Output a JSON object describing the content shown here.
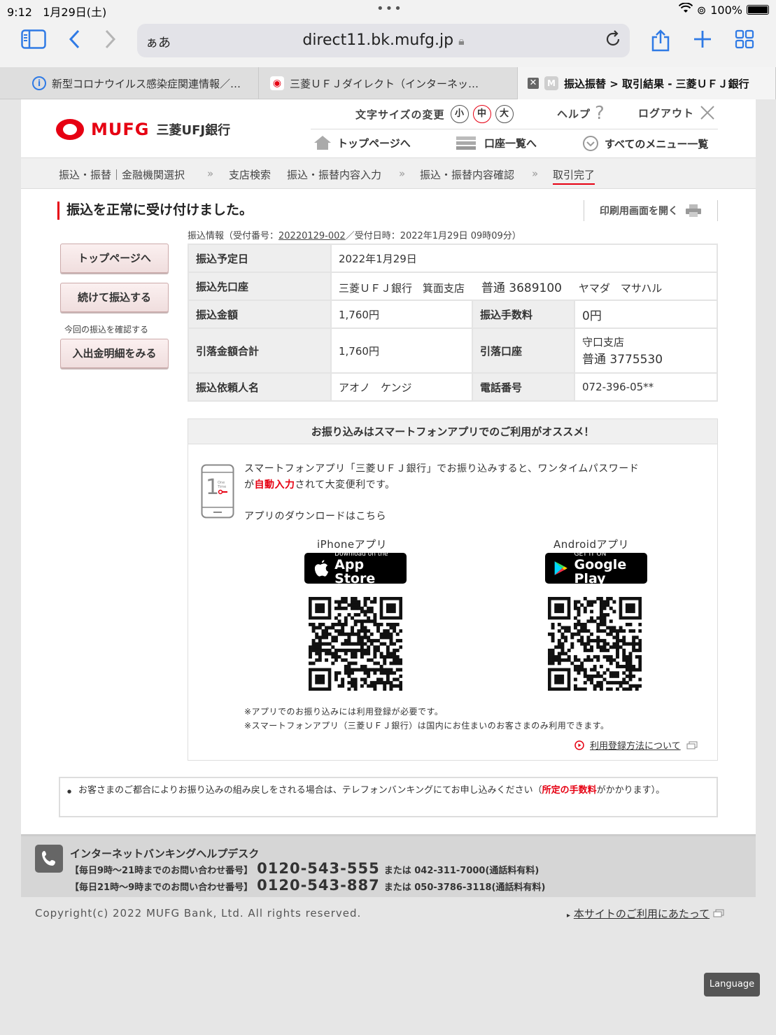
{
  "status": {
    "time": "9:12",
    "date": "1月29日(土)",
    "battery": "100%"
  },
  "browser": {
    "aa": "ぁあ",
    "url": "direct11.bk.mufg.jp",
    "tabs": [
      {
        "label": "新型コロナウイルス感染症関連情報／…"
      },
      {
        "label": "三菱ＵＦＪダイレクト（インターネッ…"
      },
      {
        "label": "振込振替 > 取引結果 - 三菱ＵＦＪ銀行",
        "favicon": "M"
      }
    ]
  },
  "header": {
    "logo_text": "MUFG",
    "bank_name": "三菱UFJ銀行",
    "font_size_label": "文字サイズの変更",
    "font_sizes": [
      "小",
      "中",
      "大"
    ],
    "help": "ヘルプ",
    "logout": "ログアウト",
    "nav": [
      "トップページへ",
      "口座一覧へ",
      "すべてのメニュー一覧"
    ]
  },
  "breadcrumb": [
    "振込・振替｜金融機関選択",
    "支店検索",
    "振込・振替内容入力",
    "振込・振替内容確認",
    "取引完了"
  ],
  "main": {
    "title": "振込を正常に受け付けました。",
    "print_label": "印刷用画面を開く",
    "info_prefix": "振込情報（受付番号：",
    "receipt_no": "20220129-002",
    "info_suffix": "／受付日時：2022年1月29日 09時09分）",
    "buttons": {
      "top": "トップページへ",
      "continue": "続けて振込する",
      "statement": "入出金明細をみる"
    },
    "confirm_note": "今回の振込を確認する",
    "table": {
      "date_label": "振込予定日",
      "date": "2022年1月29日",
      "dest_label": "振込先口座",
      "dest_bank": "三菱ＵＦＪ銀行　箕面支店",
      "dest_account": "普通 3689100",
      "dest_name": "ヤマダ　マサハル",
      "amount_label": "振込金額",
      "amount": "1,760円",
      "fee_label": "振込手数料",
      "fee": "0円",
      "total_label": "引落金額合計",
      "total": "1,760円",
      "debit_label": "引落口座",
      "debit_branch": "守口支店",
      "debit_account": "普通 3775530",
      "requester_label": "振込依頼人名",
      "requester": "アオノ　ケンジ",
      "phone_label": "電話番号",
      "phone": "072-396-05**"
    }
  },
  "promo": {
    "header": "お振り込みはスマートフォンアプリでのご利用がオススメ！",
    "line1": "スマートフォンアプリ「三菱ＵＦＪ銀行」でお振り込みすると、ワンタイムパスワード",
    "line2_pre": "が",
    "line2_red": "自動入力",
    "line2_post": "されて大変便利です。",
    "download": "アプリのダウンロードはこちら",
    "iphone_label": "iPhoneアプリ",
    "android_label": "Androidアプリ",
    "appstore_small": "Download on the",
    "appstore_big": "App Store",
    "gplay_small": "GET IT ON",
    "gplay_big": "Google Play",
    "phone_icon_digit": "1",
    "phone_icon_text": "One Time",
    "note1": "※アプリでのお振り込みには利用登録が必要です。",
    "note2": "※スマートフォンアプリ（三菱ＵＦＪ銀行）は国内にお住まいのお客さまのみ利用できます。",
    "reg_link": "利用登録方法について"
  },
  "notice": {
    "pre": "お客さまのご都合によりお振り込みの組み戻しをされる場合は、テレフォンバンキングにてお申し込みください（",
    "red": "所定の手数料",
    "post": "がかかります）。"
  },
  "helpdesk": {
    "title": "インターネットバンキングヘルプデスク",
    "line1_label": "【毎日9時～21時までのお問い合わせ番号】",
    "line1_num": "0120-543-555",
    "line1_alt": "または 042-311-7000(通話料有料)",
    "line2_label": "【毎日21時～9時までのお問い合わせ番号】",
    "line2_num": "0120-543-887",
    "line2_alt": "または 050-3786-3118(通話料有料)"
  },
  "footer": {
    "copyright": "Copyright(c) 2022 MUFG Bank, Ltd. All rights reserved.",
    "terms": "本サイトのご利用にあたって",
    "language": "Language"
  }
}
